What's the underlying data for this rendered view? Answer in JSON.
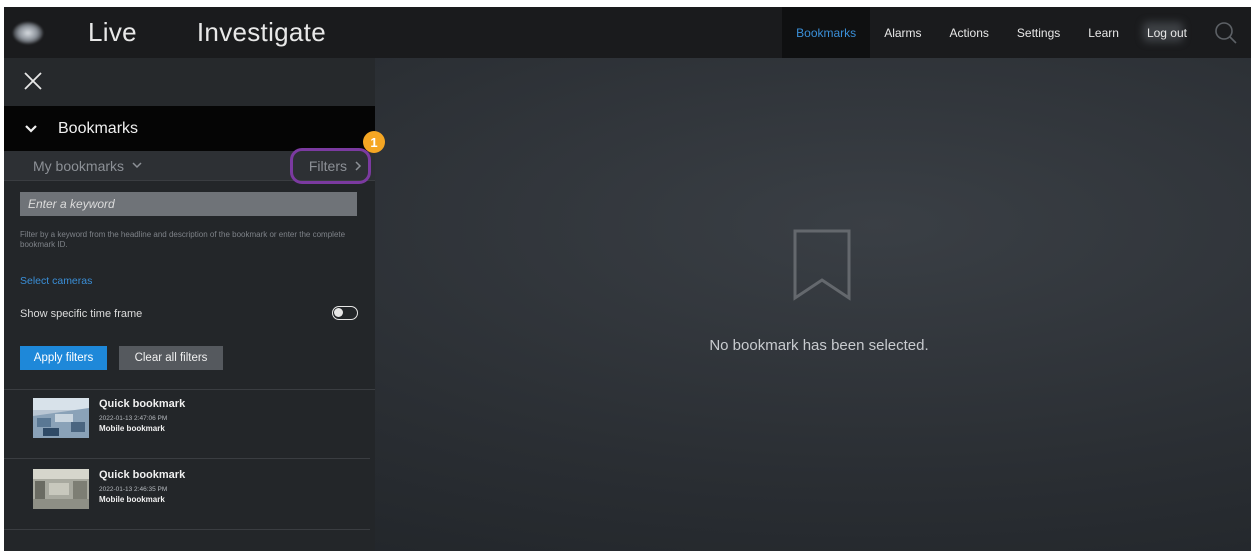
{
  "topbar": {
    "tabs": [
      "Live",
      "Investigate"
    ],
    "nav": [
      "Bookmarks",
      "Alarms",
      "Actions",
      "Settings",
      "Learn",
      "Log out"
    ],
    "active_nav": "Bookmarks",
    "search_icon": "search-icon"
  },
  "panel": {
    "header_title": "Bookmarks",
    "my_bookmarks": "My bookmarks",
    "filters": "Filters",
    "callout_number": "1",
    "keyword_placeholder": "Enter a keyword",
    "help_text": "Filter by a keyword from the headline and description of the bookmark or enter the complete bookmark ID.",
    "select_cameras": "Select cameras",
    "time_frame_label": "Show specific time frame",
    "time_frame_enabled": false,
    "apply_label": "Apply filters",
    "clear_label": "Clear all filters"
  },
  "bookmarks": [
    {
      "title": "Quick bookmark",
      "date": "2022-01-13 2:47:06 PM",
      "source": "Mobile bookmark"
    },
    {
      "title": "Quick bookmark",
      "date": "2022-01-13 2:46:35 PM",
      "source": "Mobile bookmark"
    }
  ],
  "main": {
    "empty_message": "No bookmark has been selected."
  },
  "colors": {
    "accent": "#1e88d9",
    "callout": "#f5a623",
    "highlight_outline": "#7b3aa0"
  }
}
